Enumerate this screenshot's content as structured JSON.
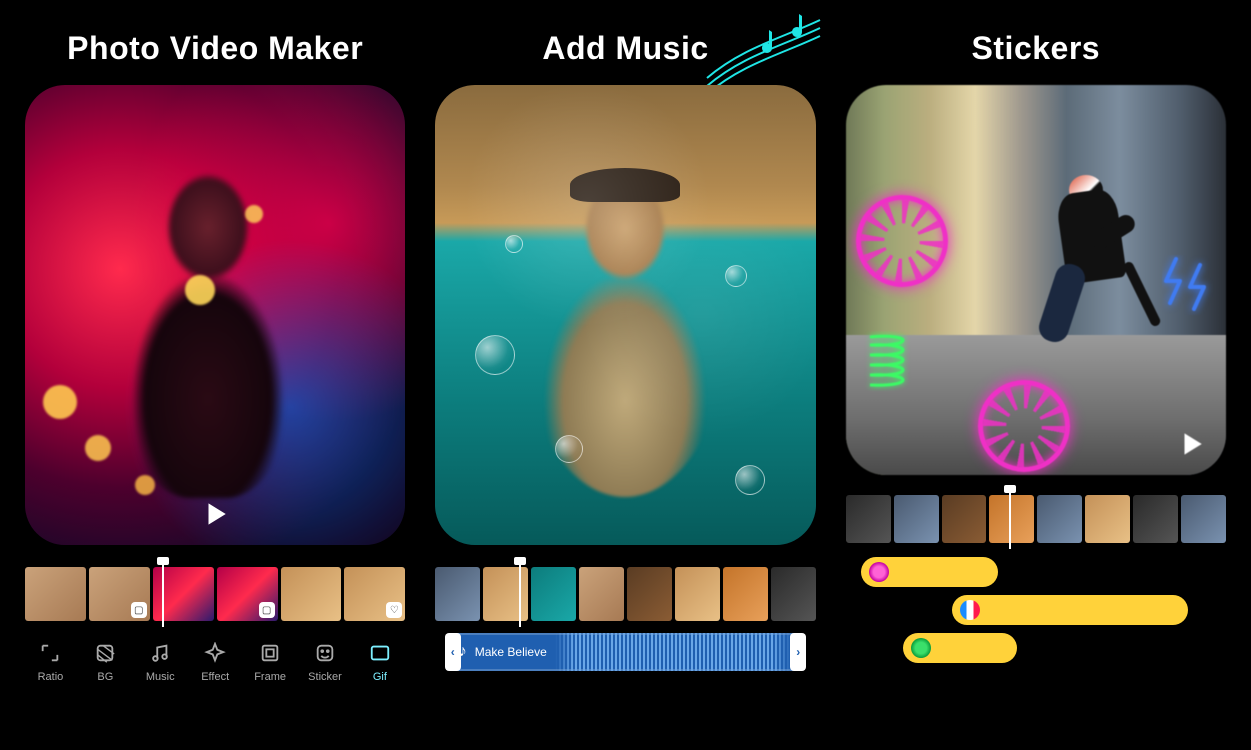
{
  "panels": [
    {
      "title": "Photo Video Maker",
      "play_button": true,
      "play_pos": "bottom-center",
      "timeline": {
        "playhead_pct": 36,
        "thumbs": [
          {
            "style": "t-skin",
            "tag": null
          },
          {
            "style": "t-skin",
            "tag": {
              "icon": "square",
              "pos": "bot"
            }
          },
          {
            "style": "t-neon",
            "tag": null
          },
          {
            "style": "t-neon",
            "tag": {
              "icon": "square",
              "pos": "bot"
            }
          },
          {
            "style": "t-warm",
            "tag": null
          },
          {
            "style": "t-warm",
            "tag": {
              "icon": "heart",
              "pos": "bot"
            }
          }
        ]
      },
      "toolbar": [
        {
          "id": "ratio",
          "label": "Ratio",
          "icon": "ratio"
        },
        {
          "id": "bg",
          "label": "BG",
          "icon": "bg"
        },
        {
          "id": "music",
          "label": "Music",
          "icon": "music"
        },
        {
          "id": "effect",
          "label": "Effect",
          "icon": "effect"
        },
        {
          "id": "frame",
          "label": "Frame",
          "icon": "frame"
        },
        {
          "id": "sticker",
          "label": "Sticker",
          "icon": "sticker"
        },
        {
          "id": "gif",
          "label": "Gif",
          "icon": "gif",
          "active": true
        }
      ]
    },
    {
      "title": "Add Music",
      "timeline": {
        "playhead_pct": 22,
        "thumbs": [
          {
            "style": "t-cool"
          },
          {
            "style": "t-warm"
          },
          {
            "style": "t-teal"
          },
          {
            "style": "t-skin"
          },
          {
            "style": "t-brown"
          },
          {
            "style": "t-warm"
          },
          {
            "style": "t-orange"
          },
          {
            "style": "t-dark"
          }
        ]
      },
      "music_track": {
        "icon": "music",
        "name": "Make Believe"
      }
    },
    {
      "title": "Stickers",
      "play_button": true,
      "play_pos": "bottom-right",
      "timeline": {
        "playhead_pct": 43,
        "thumbs": [
          {
            "style": "t-dark"
          },
          {
            "style": "t-cool"
          },
          {
            "style": "t-brown"
          },
          {
            "style": "t-orange"
          },
          {
            "style": "t-cool"
          },
          {
            "style": "t-warm"
          },
          {
            "style": "t-dark"
          },
          {
            "style": "t-cool"
          }
        ]
      },
      "sticker_lanes": [
        {
          "left_pct": 4,
          "width_pct": 36,
          "icon": "ci-pink"
        },
        {
          "left_pct": 28,
          "width_pct": 62,
          "icon": "ci-blue"
        },
        {
          "left_pct": 15,
          "width_pct": 30,
          "icon": "ci-green"
        }
      ]
    }
  ]
}
